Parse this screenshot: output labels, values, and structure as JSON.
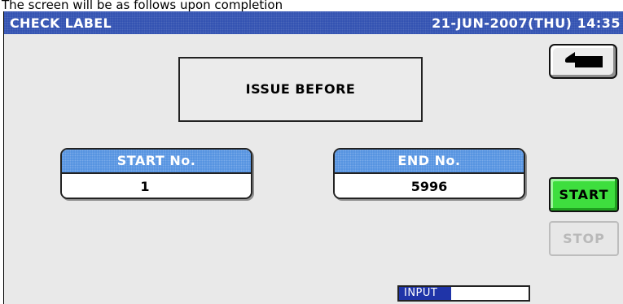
{
  "caption": "The screen will be as follows upon completion",
  "header": {
    "title": "CHECK LABEL",
    "datetime": "21-JUN-2007(THU) 14:35"
  },
  "icons": {
    "back": "back-arrow-icon"
  },
  "status": {
    "message": "ISSUE BEFORE"
  },
  "start_no": {
    "label": "START No.",
    "value": "1"
  },
  "end_no": {
    "label": "END No.",
    "value": "5996"
  },
  "buttons": {
    "start": "START",
    "stop": "STOP"
  },
  "input_indicator": {
    "label": "INPUT"
  },
  "colors": {
    "titlebar": "#2f4fb0",
    "field_header": "#4f8fe0",
    "start_button": "#3ede3e",
    "input_label": "#1f34a8",
    "screen_background": "#e9e9e9"
  }
}
